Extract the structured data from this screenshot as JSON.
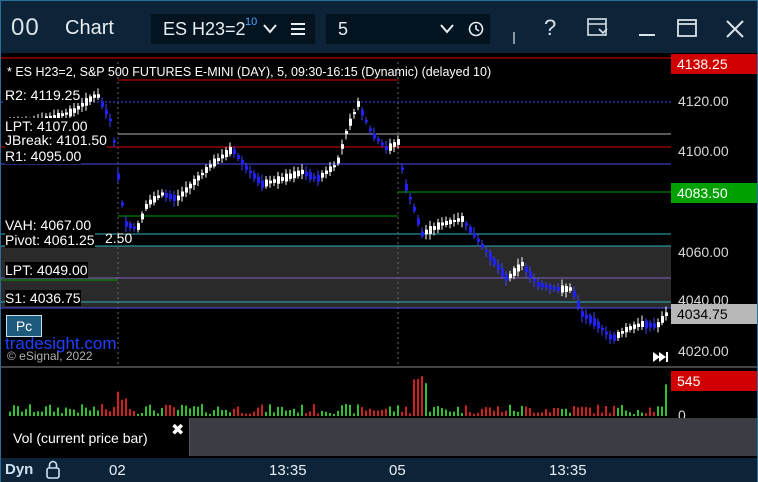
{
  "window": {
    "app_icon_glyph": "00",
    "title": "Chart",
    "symbol": "ES H23=2",
    "symbol_superscript": "10",
    "interval": "5"
  },
  "chart": {
    "header": "* ES H23=2, S&P 500 FUTURES E-MINI (DAY), 5, 09:30-16:15 (Dynamic) (delayed 10)",
    "watermark_site": "tradesight.com",
    "copyright": "© eSignal, 2022",
    "pc_button": "Pc",
    "levels": [
      {
        "label": "R2: 4119.25"
      },
      {
        "label": "LPT: 4107.00"
      },
      {
        "label": "JBreak: 4101.50"
      },
      {
        "label": "R1: 4095.00"
      },
      {
        "label": "VAH: 4067.00"
      },
      {
        "label": "Pivot: 4061.25"
      },
      {
        "label": "LPT: 4049.00"
      },
      {
        "label": "S1: 4036.75"
      }
    ],
    "partial_label_1": "2.50",
    "price_axis": [
      "4120.00",
      "4100.00",
      "4060.00",
      "4040.00",
      "4020.00"
    ],
    "price_boxes": {
      "top": "4138.25",
      "green": "4083.50",
      "last": "4034.75"
    },
    "volume_last": "545",
    "volume_zero": "0",
    "vol_tab": "Vol (current price bar)",
    "time_axis": [
      "02",
      "13:35",
      "05",
      "13:35"
    ],
    "bottom_label": "Dyn",
    "colors": {
      "red": "#e00000",
      "green": "#00a000",
      "up_candle": "#ffffff",
      "down_candle": "#2020ff",
      "cyan": "#30b0c0",
      "purple": "#8060c0"
    }
  }
}
